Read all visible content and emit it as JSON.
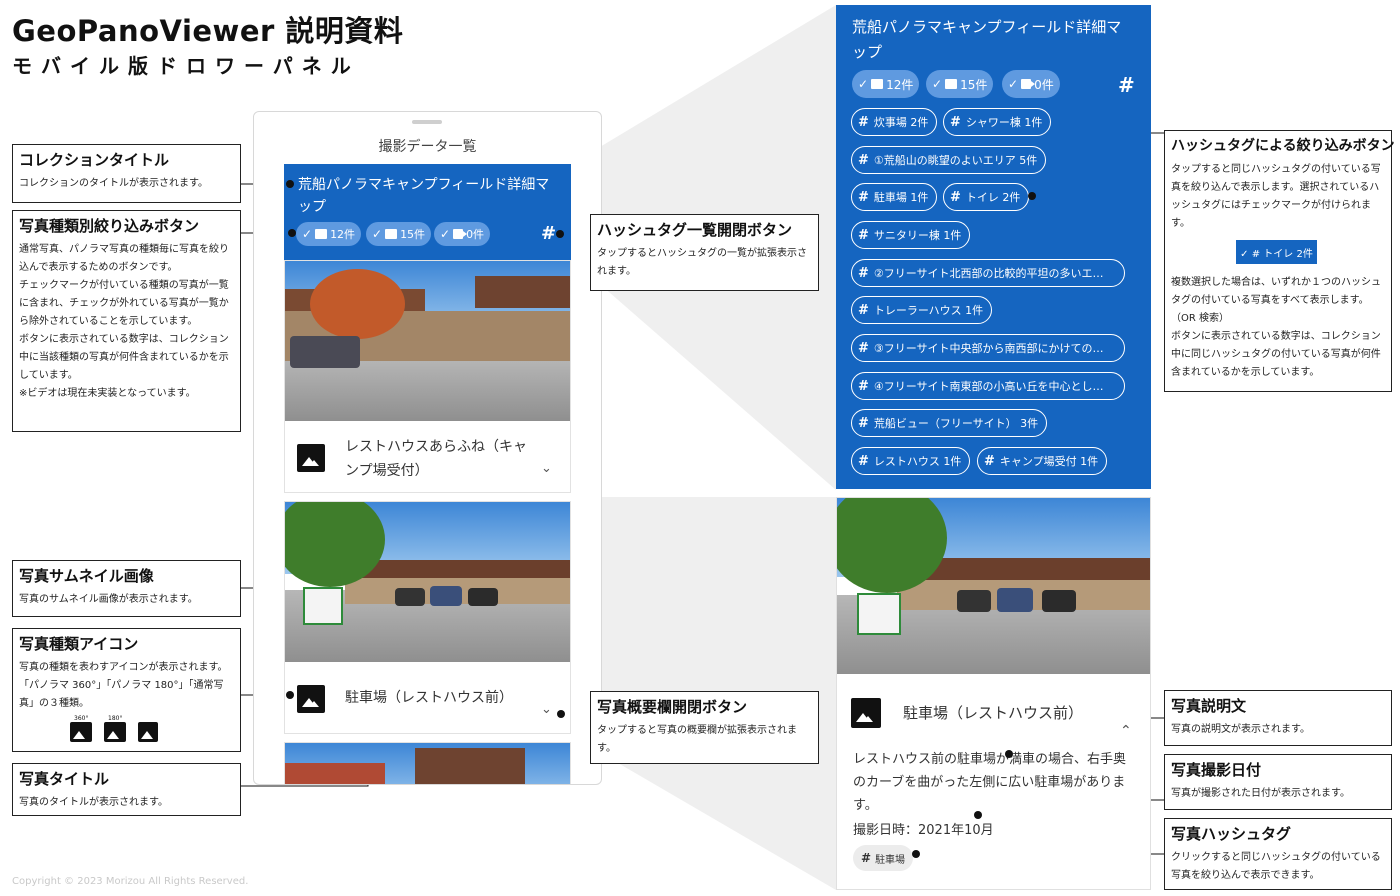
{
  "header": {
    "title": "GeoPanoViewer 説明資料",
    "subtitle": "モバイル版ドロワーパネル"
  },
  "copyright": "Copyright © 2023 Morizou All Rights Reserved.",
  "drawer": {
    "title": "撮影データ一覧",
    "collection_title": "荒船パノラマキャンプフィールド詳細マップ",
    "filters": {
      "photo": "12件",
      "panorama": "15件",
      "video": "0件"
    },
    "hashtag_button": "#"
  },
  "cards": [
    {
      "title": "レストハウスあらふね（キャンプ場受付）",
      "chevron": "⌄"
    },
    {
      "title": "駐車場（レストハウス前）",
      "chevron": "⌄"
    }
  ],
  "annotations": {
    "collection_title": {
      "title": "コレクションタイトル",
      "body": "コレクションのタイトルが表示されます。"
    },
    "type_filter": {
      "title": "写真種類別絞り込みボタン",
      "body": "通常写真、パノラマ写真の種類毎に写真を絞り込んで表示するためのボタンです。\nチェックマークが付いている種類の写真が一覧に含まれ、チェックが外れている写真が一覧から除外されていることを示しています。\nボタンに表示されている数字は、コレクション中に当該種類の写真が何件含まれているかを示しています。\n※ビデオは現在未実装となっています。"
    },
    "hashtag_open": {
      "title": "ハッシュタグ一覧開閉ボタン",
      "body": "タップするとハッシュタグの一覧が拡張表示されます。"
    },
    "thumbnail": {
      "title": "写真サムネイル画像",
      "body": "写真のサムネイル画像が表示されます。"
    },
    "type_icon": {
      "title": "写真種類アイコン",
      "body": "写真の種類を表わすアイコンが表示されます。\n「パノラマ 360°」「パノラマ 180°」「通常写真」の３種類。"
    },
    "photo_title": {
      "title": "写真タイトル",
      "body": "写真のタイトルが表示されます。"
    },
    "overview_toggle": {
      "title": "写真概要欄開閉ボタン",
      "body": "タップすると写真の概要欄が拡張表示されます。"
    },
    "hashtag_filter": {
      "title": "ハッシュタグによる絞り込みボタン",
      "body_top": "タップすると同じハッシュタグの付いている写真を絞り込んで表示します。選択されているハッシュタグにはチェックマークが付けられます。",
      "body_bottom": "複数選択した場合は、いずれか１つのハッシュタグの付いている写真をすべて表示します。（OR 検索）\nボタンに表示されている数字は、コレクション中に同じハッシュタグの付いている写真が何件含まれているかを示しています。"
    },
    "photo_desc": {
      "title": "写真説明文",
      "body": "写真の説明文が表示されます。"
    },
    "photo_date": {
      "title": "写真撮影日付",
      "body": "写真が撮影された日付が表示されます。"
    },
    "photo_hashtag": {
      "title": "写真ハッシュタグ",
      "body": "クリックすると同じハッシュタグの付いている写真を絞り込んで表示できます。"
    }
  },
  "icon_labels": {
    "pano360": "360°",
    "pano180": "180°"
  },
  "selected_chip": "✓ # トイレ 2件",
  "hashtag_panel": {
    "title": "荒船パノラマキャンプフィールド詳細マップ",
    "filters": {
      "photo": "12件",
      "panorama": "15件",
      "video": "0件"
    },
    "tags": [
      "炊事場 2件",
      "シャワー棟 1件",
      "①荒船山の眺望のよいエリア 5件",
      "駐車場 1件",
      "トイレ 2件",
      "サニタリー棟 1件",
      "②フリーサイト北西部の比較的平坦の多いエ…",
      "トレーラーハウス 1件",
      "③フリーサイト中央部から南西部にかけての…",
      "④フリーサイト南東部の小高い丘を中心とし…",
      "荒船ビュー（フリーサイト） 3件",
      "レストハウス 1件",
      "キャンプ場受付 1件"
    ]
  },
  "detail": {
    "title": "駐車場（レストハウス前）",
    "chevron": "⌃",
    "description": "レストハウス前の駐車場が満車の場合、右手奥のカーブを曲がった左側に広い駐車場があります。",
    "date": "撮影日時：2021年10月",
    "hashtag": "駐車場"
  },
  "colors": {
    "accent": "#1565c0",
    "chip": "#5f9ae0"
  }
}
